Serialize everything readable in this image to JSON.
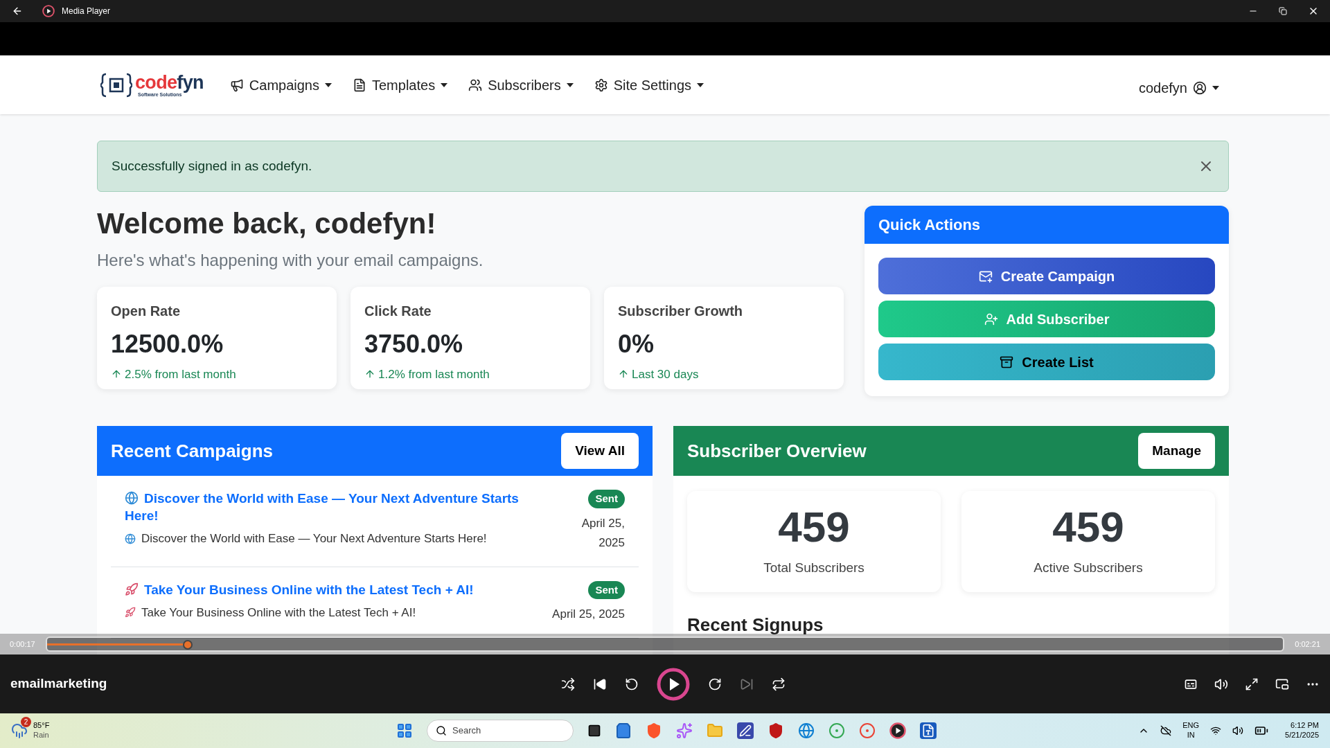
{
  "window": {
    "title": "Media Player"
  },
  "navbar": {
    "brand_parts": [
      {
        "text": "code",
        "color": "#e5383b"
      },
      {
        "text": "fyn",
        "color": "#1d3557"
      }
    ],
    "brand_tagline": "Software Solutions",
    "menu": [
      {
        "label": "Campaigns",
        "kind": "megaphone"
      },
      {
        "label": "Templates",
        "kind": "file"
      },
      {
        "label": "Subscribers",
        "kind": "users"
      },
      {
        "label": "Site Settings",
        "kind": "gear"
      }
    ],
    "user": "codefyn"
  },
  "alert": {
    "message": "Successfully signed in as codefyn."
  },
  "welcome": {
    "title": "Welcome back, codefyn!",
    "subtitle": "Here's what's happening with your email campaigns."
  },
  "stats": [
    {
      "label": "Open Rate",
      "value": "12500.0%",
      "change": "2.5% from last month"
    },
    {
      "label": "Click Rate",
      "value": "3750.0%",
      "change": "1.2% from last month"
    },
    {
      "label": "Subscriber Growth",
      "value": "0%",
      "change": "Last 30 days"
    }
  ],
  "quick_actions": {
    "title": "Quick Actions",
    "buttons": [
      {
        "label": "Create Campaign",
        "kind": "campaign"
      },
      {
        "label": "Add Subscriber",
        "kind": "subscriber"
      },
      {
        "label": "Create List",
        "kind": "list"
      }
    ]
  },
  "recent_campaigns": {
    "title": "Recent Campaigns",
    "button": "View All",
    "items": [
      {
        "kind": "globe",
        "title": "Discover the World with Ease — Your Next Adventure Starts Here!",
        "subtitle": "Discover the World with Ease — Your Next Adventure Starts Here!",
        "status": "Sent",
        "date": "April 25, 2025"
      },
      {
        "kind": "rocket",
        "title": "Take Your Business Online with the Latest Tech + AI!",
        "subtitle": "Take Your Business Online with the Latest Tech + AI!",
        "status": "Sent",
        "date": "April 25, 2025"
      }
    ]
  },
  "subscriber_overview": {
    "title": "Subscriber Overview",
    "button": "Manage",
    "stats": [
      {
        "value": "459",
        "label": "Total Subscribers"
      },
      {
        "value": "459",
        "label": "Active Subscribers"
      }
    ],
    "section_heading": "Recent Signups"
  },
  "player": {
    "elapsed": "0:00:17",
    "total": "0:02:21",
    "level": 0.114,
    "title": "emailmarketing"
  },
  "taskbar": {
    "weather_badge": "2",
    "temperature": "85°F",
    "condition": "Rain",
    "search_placeholder": "Search",
    "language": "ENG",
    "region": "IN",
    "time": "6:12 PM",
    "date": "5/21/2025"
  }
}
